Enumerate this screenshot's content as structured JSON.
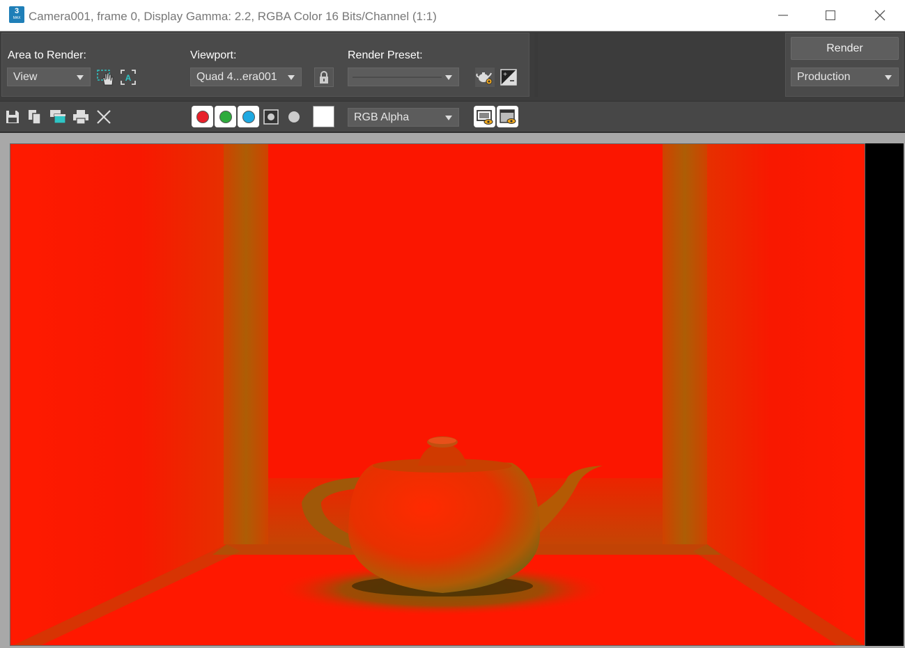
{
  "window": {
    "title": "Camera001, frame 0, Display Gamma: 2.2, RGBA Color 16 Bits/Channel (1:1)",
    "icon_label": "3",
    "icon_sub": "MAX",
    "controls": [
      "minimize-icon",
      "maximize-icon",
      "close-icon"
    ]
  },
  "render_setup": {
    "area_label": "Area to Render:",
    "area_value": "View",
    "viewport_label": "Viewport:",
    "viewport_value": "Quad 4...era001",
    "preset_label": "Render Preset:",
    "preset_value": "",
    "render_button": "Render",
    "render_mode": "Production"
  },
  "toolbar": {
    "icons": [
      "save-icon",
      "copy-icon",
      "clone-window-icon",
      "print-icon",
      "clear-icon"
    ],
    "channels": [
      {
        "name": "red",
        "color": "#e8202a",
        "active": true
      },
      {
        "name": "green",
        "color": "#2eab3c",
        "active": true
      },
      {
        "name": "blue",
        "color": "#1ea9e1",
        "active": true
      },
      {
        "name": "alpha",
        "active": false
      },
      {
        "name": "mono",
        "active": false
      }
    ],
    "swatch_color": "#ffffff",
    "channel_display": "RGB Alpha"
  },
  "colors": {
    "render_background": "#ff1400",
    "frame_olive": "#a06a06"
  }
}
